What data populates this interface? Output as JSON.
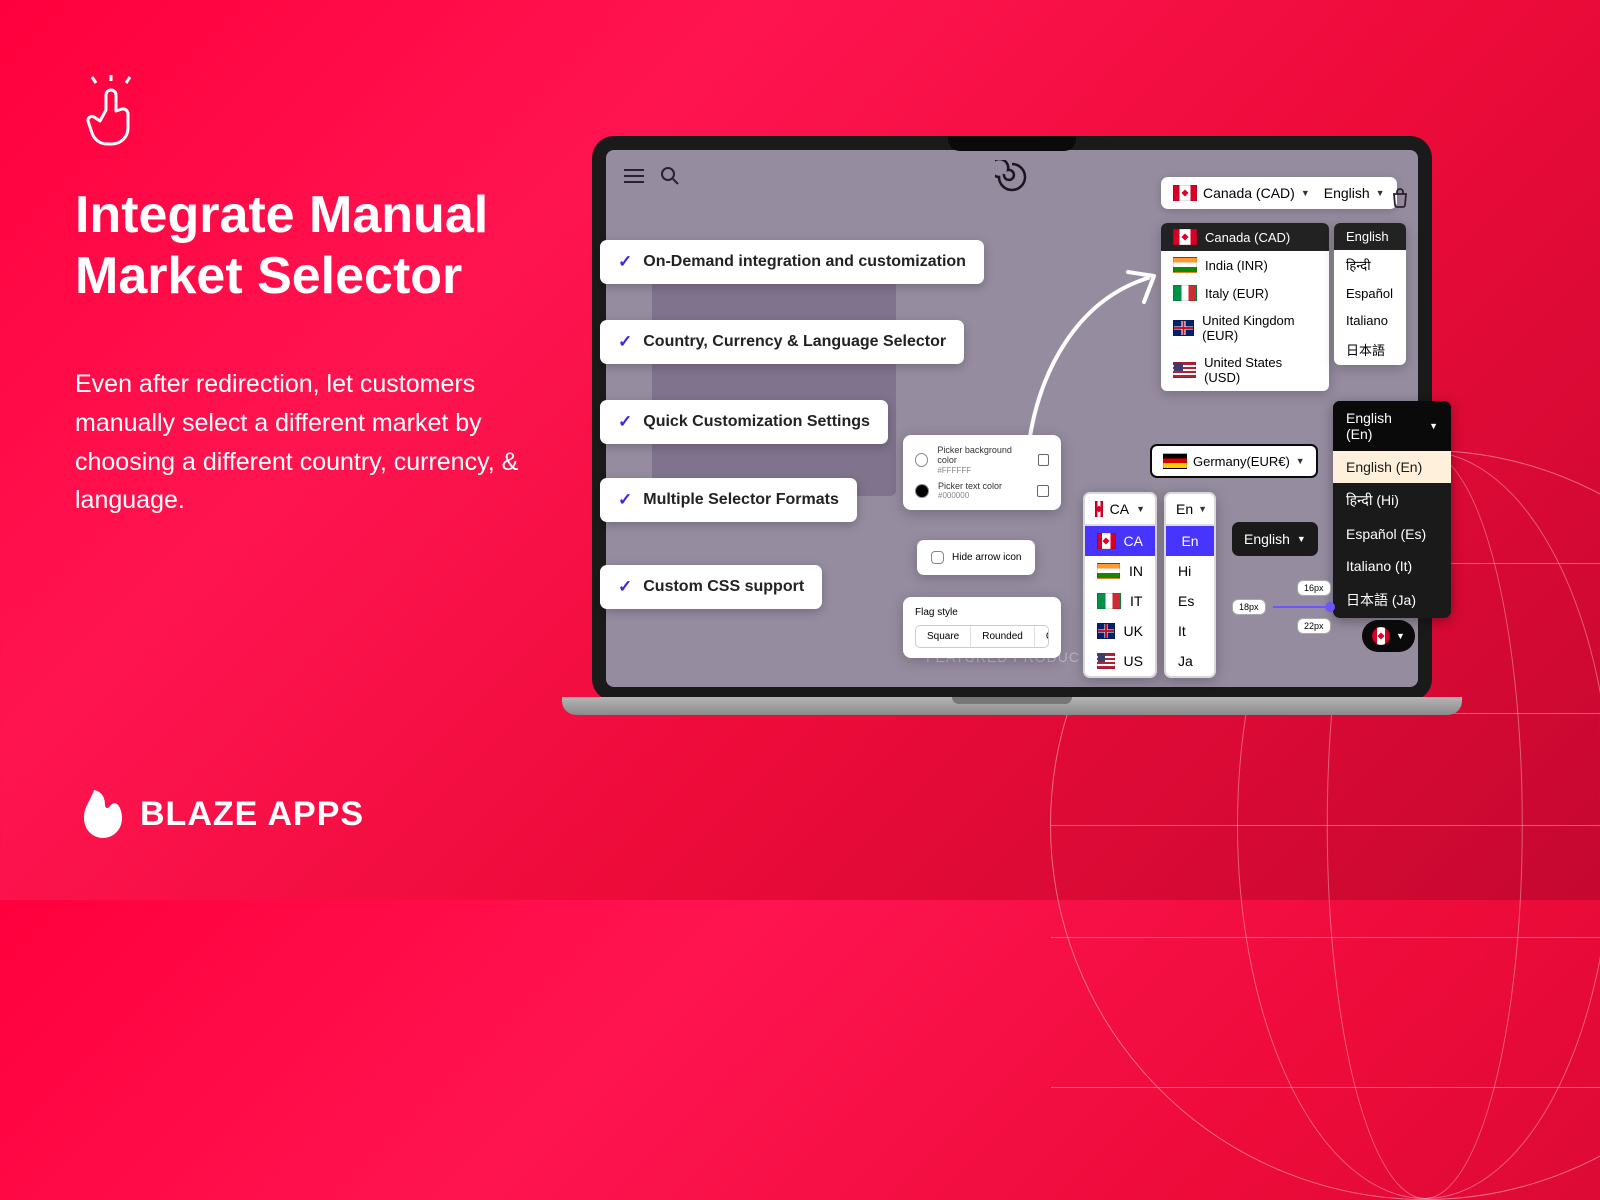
{
  "heading_line1": "Integrate Manual",
  "heading_line2": "Market Selector",
  "description": "Even after redirection, let customers manually select a different market by choosing a different country, currency, & language.",
  "brand": "BLAZE APPS",
  "features": [
    "On-Demand integration and customization",
    "Country, Currency & Language Selector",
    "Quick Customization Settings",
    "Multiple Selector Formats",
    "Custom CSS support"
  ],
  "nav_selector": {
    "country": "Canada (CAD)",
    "language": "English"
  },
  "country_dropdown": [
    {
      "code": "ca",
      "label": "Canada (CAD)",
      "selected": true
    },
    {
      "code": "in",
      "label": "India (INR)"
    },
    {
      "code": "it",
      "label": "Italy (EUR)"
    },
    {
      "code": "uk",
      "label": "United Kingdom (EUR)"
    },
    {
      "code": "us",
      "label": "United States (USD)"
    }
  ],
  "language_dropdown": [
    "English",
    "हिन्दी",
    "Español",
    "Italiano",
    "日本語"
  ],
  "dark_language": {
    "header": "English (En)",
    "items": [
      {
        "label": "English (En)",
        "active": true
      },
      {
        "label": "हिन्दी (Hi)"
      },
      {
        "label": "Español (Es)"
      },
      {
        "label": "Italiano (It)"
      },
      {
        "label": "日本語 (Ja)"
      }
    ]
  },
  "germany_pill": "Germany(EUR€)",
  "english_dark_pill": "English",
  "color_picker": {
    "bg_label": "Picker background color",
    "bg_value": "#FFFFFF",
    "text_label": "Picker text color",
    "text_value": "#000000"
  },
  "hide_arrow": "Hide arrow icon",
  "flag_style": {
    "label": "Flag style",
    "options": [
      "Square",
      "Rounded",
      "Circle"
    ]
  },
  "short_country": {
    "header": "CA",
    "items": [
      {
        "code": "ca",
        "label": "CA"
      },
      {
        "code": "in",
        "label": "IN"
      },
      {
        "code": "it",
        "label": "IT"
      },
      {
        "code": "uk",
        "label": "UK"
      },
      {
        "code": "us",
        "label": "US"
      }
    ]
  },
  "short_lang": {
    "header": "En",
    "items": [
      "En",
      "Hi",
      "Es",
      "It",
      "Ja"
    ]
  },
  "featured_text": "FEATURED PRODUC",
  "sizes": {
    "a": "16px",
    "b": "18px",
    "c": "22px"
  }
}
